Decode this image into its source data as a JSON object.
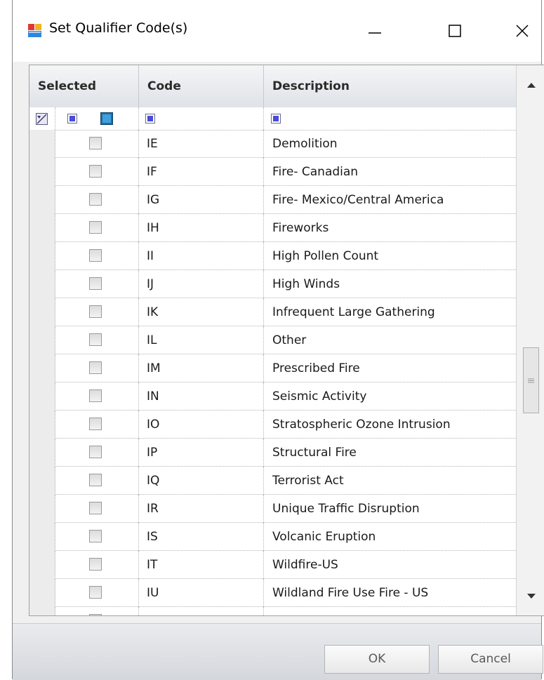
{
  "window": {
    "title": "Set Qualifier Code(s)"
  },
  "grid": {
    "columns": [
      "Selected",
      "Code",
      "Description"
    ],
    "rows": [
      {
        "code": "IE",
        "description": "Demolition",
        "selected": false
      },
      {
        "code": "IF",
        "description": "Fire- Canadian",
        "selected": false
      },
      {
        "code": "IG",
        "description": "Fire- Mexico/Central America",
        "selected": false
      },
      {
        "code": "IH",
        "description": "Fireworks",
        "selected": false
      },
      {
        "code": "II",
        "description": "High Pollen Count",
        "selected": false
      },
      {
        "code": "IJ",
        "description": "High Winds",
        "selected": false
      },
      {
        "code": "IK",
        "description": "Infrequent Large Gathering",
        "selected": false
      },
      {
        "code": "IL",
        "description": "Other",
        "selected": false
      },
      {
        "code": "IM",
        "description": "Prescribed Fire",
        "selected": false
      },
      {
        "code": "IN",
        "description": "Seismic Activity",
        "selected": false
      },
      {
        "code": "IO",
        "description": "Stratospheric Ozone Intrusion",
        "selected": false
      },
      {
        "code": "IP",
        "description": "Structural Fire",
        "selected": false
      },
      {
        "code": "IQ",
        "description": "Terrorist Act",
        "selected": false
      },
      {
        "code": "IR",
        "description": "Unique Traffic Disruption",
        "selected": false
      },
      {
        "code": "IS",
        "description": "Volcanic Eruption",
        "selected": false
      },
      {
        "code": "IT",
        "description": "Wildfire-US",
        "selected": false
      },
      {
        "code": "IU",
        "description": "Wildland Fire Use Fire - US",
        "selected": false
      }
    ]
  },
  "buttons": {
    "ok": "OK",
    "cancel": "Cancel"
  },
  "colors": {
    "filter_accent": "#4a4adb",
    "header_bg": "#dfe2e7"
  }
}
